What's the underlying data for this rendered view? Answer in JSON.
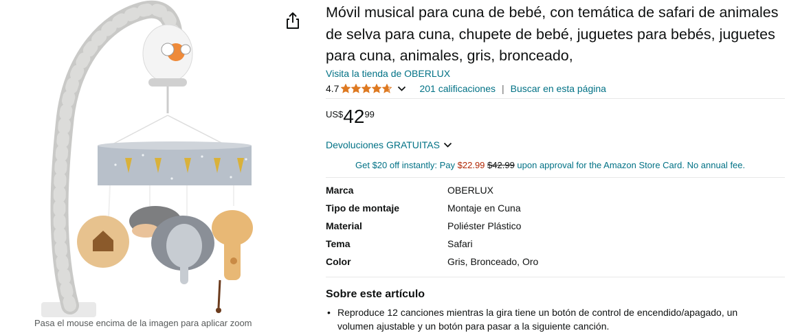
{
  "image": {
    "zoom_hint": "Pasa el mouse encima de la imagen para aplicar zoom"
  },
  "share": {
    "icon": "share-icon"
  },
  "product": {
    "title": "Móvil musical para cuna de bebé, con temática de safari de animales de selva para cuna, chupete de bebé, juguetes para bebés, juguetes para cuna, animales, gris, bronceado,",
    "store_link": "Visita la tienda de OBERLUX",
    "rating": {
      "value": "4.7",
      "stars": 4.7,
      "count_label": "201 calificaciones",
      "separator": "|",
      "search_label": "Buscar en esta página"
    },
    "price": {
      "symbol": "US$",
      "whole": "42",
      "fraction": "99"
    },
    "returns_label": "Devoluciones GRATUITAS",
    "promo": {
      "prefix": "Get $20 off instantly: Pay",
      "sale_price": "$22.99",
      "original_price": "$42.99",
      "suffix": "upon approval for the Amazon Store Card. No annual fee."
    },
    "specs": [
      {
        "label": "Marca",
        "value": "OBERLUX"
      },
      {
        "label": "Tipo de montaje",
        "value": "Montaje en Cuna"
      },
      {
        "label": "Material",
        "value": "Poliéster Plástico"
      },
      {
        "label": "Tema",
        "value": "Safari"
      },
      {
        "label": "Color",
        "value": "Gris, Bronceado, Oro"
      }
    ],
    "about_heading": "Sobre este artículo",
    "bullets": [
      "Reproduce 12 canciones mientras la gira tiene un botón de control de encendido/apagado, un volumen ajustable y un botón para pasar a la siguiente canción."
    ]
  },
  "colors": {
    "link": "#007185",
    "star": "#de7921",
    "sale": "#b12704",
    "text": "#0f1111"
  }
}
